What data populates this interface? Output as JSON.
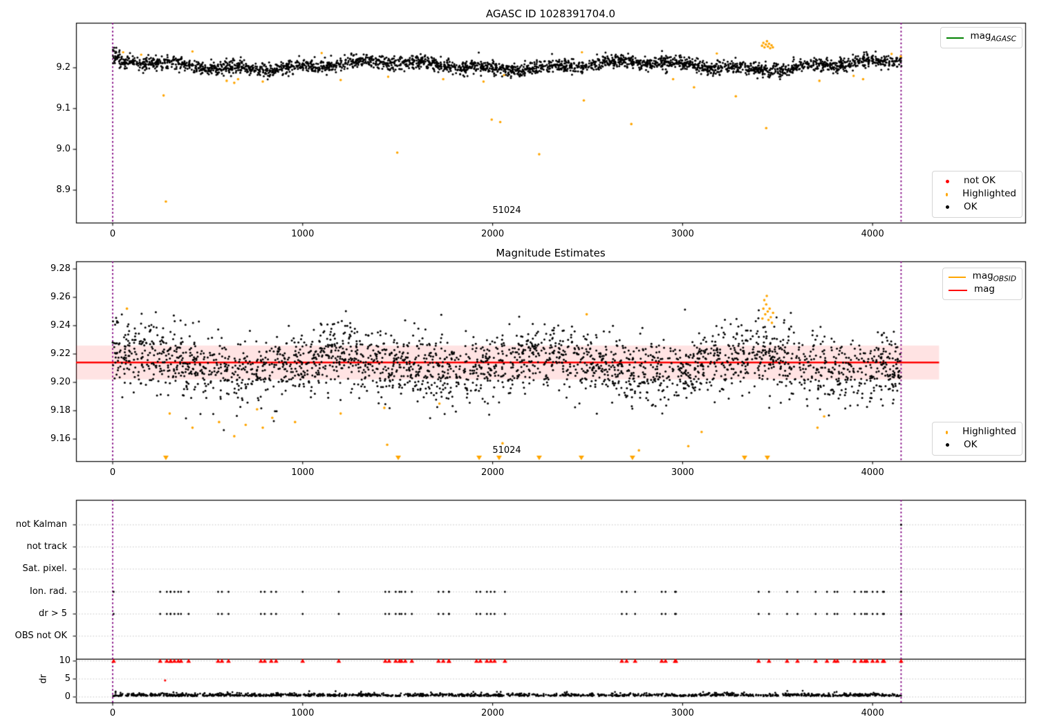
{
  "figure_title": "AGASC ID 1028391704.0",
  "colors": {
    "ok_points": "#000000",
    "highlighted_points": "#FFA500",
    "not_ok_points": "#FF0000",
    "mag_line": "#FF0000",
    "mag_band": "rgba(255,0,0,0.11)",
    "mag_agasc_line": "#008000",
    "mag_obsid_line": "#FFA500",
    "obsid_vline": "#800080",
    "grid": "#b8b8b8",
    "frame": "#000000"
  },
  "chart_data": [
    {
      "type": "scatter",
      "title": "AGASC ID 1028391704.0",
      "xlim": [
        -193,
        4803
      ],
      "ylim": [
        8.82,
        9.31
      ],
      "xticks": [
        0,
        1000,
        2000,
        3000,
        4000
      ],
      "yticks": [
        "9.2",
        "9.1",
        "9.0",
        "8.9"
      ],
      "obsid_annotation": {
        "text": "51024",
        "x": 2074
      },
      "vlines": {
        "x": [
          0,
          4150
        ],
        "style": "dotted"
      },
      "legend_upper": [
        {
          "label_base": "mag",
          "label_sub": "AGASC",
          "kind": "line",
          "color": "#008000",
          "line_hidden_under_data": true
        }
      ],
      "legend_lower": [
        {
          "label": "not OK",
          "color": "#FF0000",
          "kind": "dot"
        },
        {
          "label": "Highlighted",
          "color": "#FFA500",
          "kind": "dot"
        },
        {
          "label": "OK",
          "color": "#000000",
          "kind": "dot"
        }
      ],
      "ok_series": {
        "n": 2800,
        "x_range": [
          0,
          4152
        ],
        "mean": 9.206,
        "sigma": 0.0082,
        "wave": [
          [
            0.009,
            210,
            1.1
          ],
          [
            0.004,
            53,
            2.0
          ]
        ],
        "clamp": [
          9.17,
          9.255
        ],
        "start_bump": 0.02
      },
      "highlighted_outliers": [
        [
          280,
          8.872
        ],
        [
          268,
          9.132
        ],
        [
          600,
          9.168
        ],
        [
          640,
          9.163
        ],
        [
          660,
          9.172
        ],
        [
          790,
          9.166
        ],
        [
          1200,
          9.17
        ],
        [
          1498,
          8.992
        ],
        [
          1740,
          9.172
        ],
        [
          1952,
          9.166
        ],
        [
          1995,
          9.073
        ],
        [
          2040,
          9.067
        ],
        [
          2245,
          8.988
        ],
        [
          2480,
          9.12
        ],
        [
          2730,
          9.062
        ],
        [
          2950,
          9.172
        ],
        [
          3060,
          9.152
        ],
        [
          3280,
          9.13
        ],
        [
          3440,
          9.052
        ],
        [
          3720,
          9.168
        ],
        [
          3950,
          9.172
        ]
      ],
      "highlighted_scatter": [
        [
          55,
          9.238
        ],
        [
          150,
          9.232
        ],
        [
          420,
          9.24
        ],
        [
          1100,
          9.236
        ],
        [
          1450,
          9.178
        ],
        [
          2060,
          9.182
        ],
        [
          2470,
          9.238
        ],
        [
          3180,
          9.235
        ],
        [
          3900,
          9.18
        ],
        [
          4100,
          9.234
        ],
        [
          4148,
          9.228
        ]
      ],
      "highlighted_cluster": [
        [
          3418,
          9.254
        ],
        [
          3425,
          9.261
        ],
        [
          3431,
          9.25
        ],
        [
          3438,
          9.257
        ],
        [
          3444,
          9.265
        ],
        [
          3449,
          9.252
        ],
        [
          3455,
          9.259
        ],
        [
          3461,
          9.248
        ],
        [
          3468,
          9.255
        ],
        [
          3475,
          9.25
        ]
      ]
    },
    {
      "type": "scatter",
      "title": "Magnitude Estimates",
      "xlim": [
        -193,
        4803
      ],
      "ylim": [
        9.144,
        9.285
      ],
      "xticks": [
        0,
        1000,
        2000,
        3000,
        4000
      ],
      "yticks": [
        "9.28",
        "9.26",
        "9.24",
        "9.22",
        "9.20",
        "9.18",
        "9.16"
      ],
      "mag_line": {
        "value": 9.214,
        "x_start": -193,
        "x_end": 4350
      },
      "mag_band": {
        "low": 9.202,
        "high": 9.226,
        "x_start": -193,
        "x_end": 4350
      },
      "obsid_annotation": {
        "text": "51024",
        "x": 2074
      },
      "vlines": {
        "x": [
          0,
          4150
        ],
        "style": "dotted"
      },
      "legend_upper": [
        {
          "label_base": "mag",
          "label_sub": "OBSID",
          "kind": "line",
          "color": "#FFA500"
        },
        {
          "label_base": "mag",
          "label_sub": "",
          "kind": "line",
          "color": "#FF0000"
        }
      ],
      "legend_lower": [
        {
          "label": "Highlighted",
          "color": "#FFA500",
          "kind": "dot"
        },
        {
          "label": "OK",
          "color": "#000000",
          "kind": "dot"
        }
      ],
      "ok_series": {
        "n": 2600,
        "x_range": [
          0,
          4152
        ],
        "mean": 9.213,
        "sigma": 0.0115,
        "wave": [
          [
            0.0058,
            170,
            0.7
          ]
        ],
        "clamp": [
          9.153,
          9.256
        ],
        "low_dip_x": [
          150,
          900
        ]
      },
      "highlighted_points": [
        [
          75,
          9.252
        ],
        [
          300,
          9.178
        ],
        [
          420,
          9.168
        ],
        [
          560,
          9.172
        ],
        [
          640,
          9.162
        ],
        [
          700,
          9.17
        ],
        [
          760,
          9.181
        ],
        [
          790,
          9.168
        ],
        [
          840,
          9.175
        ],
        [
          960,
          9.172
        ],
        [
          1200,
          9.178
        ],
        [
          1430,
          9.182
        ],
        [
          1445,
          9.156
        ],
        [
          1720,
          9.185
        ],
        [
          2052,
          9.157
        ],
        [
          2495,
          9.248
        ],
        [
          2770,
          9.152
        ],
        [
          3030,
          9.155
        ],
        [
          3100,
          9.165
        ],
        [
          3710,
          9.168
        ],
        [
          3745,
          9.176
        ]
      ],
      "highlighted_cluster": [
        [
          3420,
          9.245
        ],
        [
          3425,
          9.252
        ],
        [
          3430,
          9.258
        ],
        [
          3435,
          9.248
        ],
        [
          3440,
          9.255
        ],
        [
          3443,
          9.261
        ],
        [
          3448,
          9.25
        ],
        [
          3452,
          9.244
        ],
        [
          3458,
          9.252
        ],
        [
          3464,
          9.246
        ],
        [
          3470,
          9.242
        ],
        [
          3476,
          9.249
        ]
      ],
      "clipped_low_x": [
        280,
        1503,
        1929,
        2034,
        2245,
        2467,
        2736,
        3326,
        3446
      ]
    },
    {
      "type": "flags",
      "rows": [
        "not Kalman",
        "not track",
        "Sat. pixel.",
        "Ion. rad.",
        "dr > 5",
        "OBS not OK"
      ],
      "ylabel": "dr",
      "dr_ticks": [
        "10",
        "5",
        "0"
      ],
      "xticks": [
        0,
        1000,
        2000,
        3000,
        4000
      ],
      "hline_dr": 10.5,
      "flag_cluster_x": [
        5,
        250,
        285,
        305,
        325,
        345,
        555,
        575,
        780,
        800,
        860,
        1000,
        1190,
        1435,
        1455,
        1520,
        1540,
        1715,
        1740,
        1770,
        1915,
        1935,
        1990,
        2010,
        2680,
        2705,
        2750,
        2890,
        2910,
        2960,
        3400,
        3550,
        3700,
        3760,
        3800,
        3905,
        3940,
        3970,
        4000,
        4060,
        4150
      ],
      "flag_rows_with_points": [
        "Ion. rad.",
        "dr > 5"
      ],
      "not_kalman_x": [
        4150
      ],
      "red_dr10_x": "same as flag_cluster_x",
      "red_extra_points": [
        [
          276,
          4.6
        ]
      ],
      "dr_series": {
        "n": 1400,
        "x_range": [
          0,
          4152
        ],
        "base": 0.18,
        "sigma": 0.32,
        "max": 2.4
      },
      "vlines": {
        "x": [
          0,
          4150
        ],
        "style": "dotted"
      }
    }
  ]
}
